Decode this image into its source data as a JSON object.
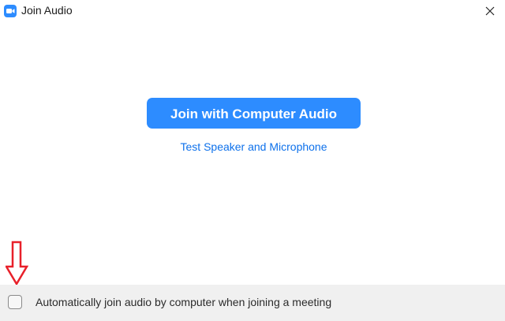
{
  "window": {
    "title": "Join Audio",
    "icon": "zoom-camera-icon",
    "close_icon": "close-icon"
  },
  "main": {
    "join_button_label": "Join with Computer Audio",
    "test_link_label": "Test Speaker and Microphone"
  },
  "footer": {
    "auto_join_checked": false,
    "auto_join_label": "Automatically join audio by computer when joining a meeting"
  },
  "annotation": {
    "icon": "down-arrow-icon",
    "color": "#e8202a"
  },
  "colors": {
    "accent": "#2d8cff",
    "link": "#0e71eb",
    "footer_bg": "#f0f0f0"
  }
}
